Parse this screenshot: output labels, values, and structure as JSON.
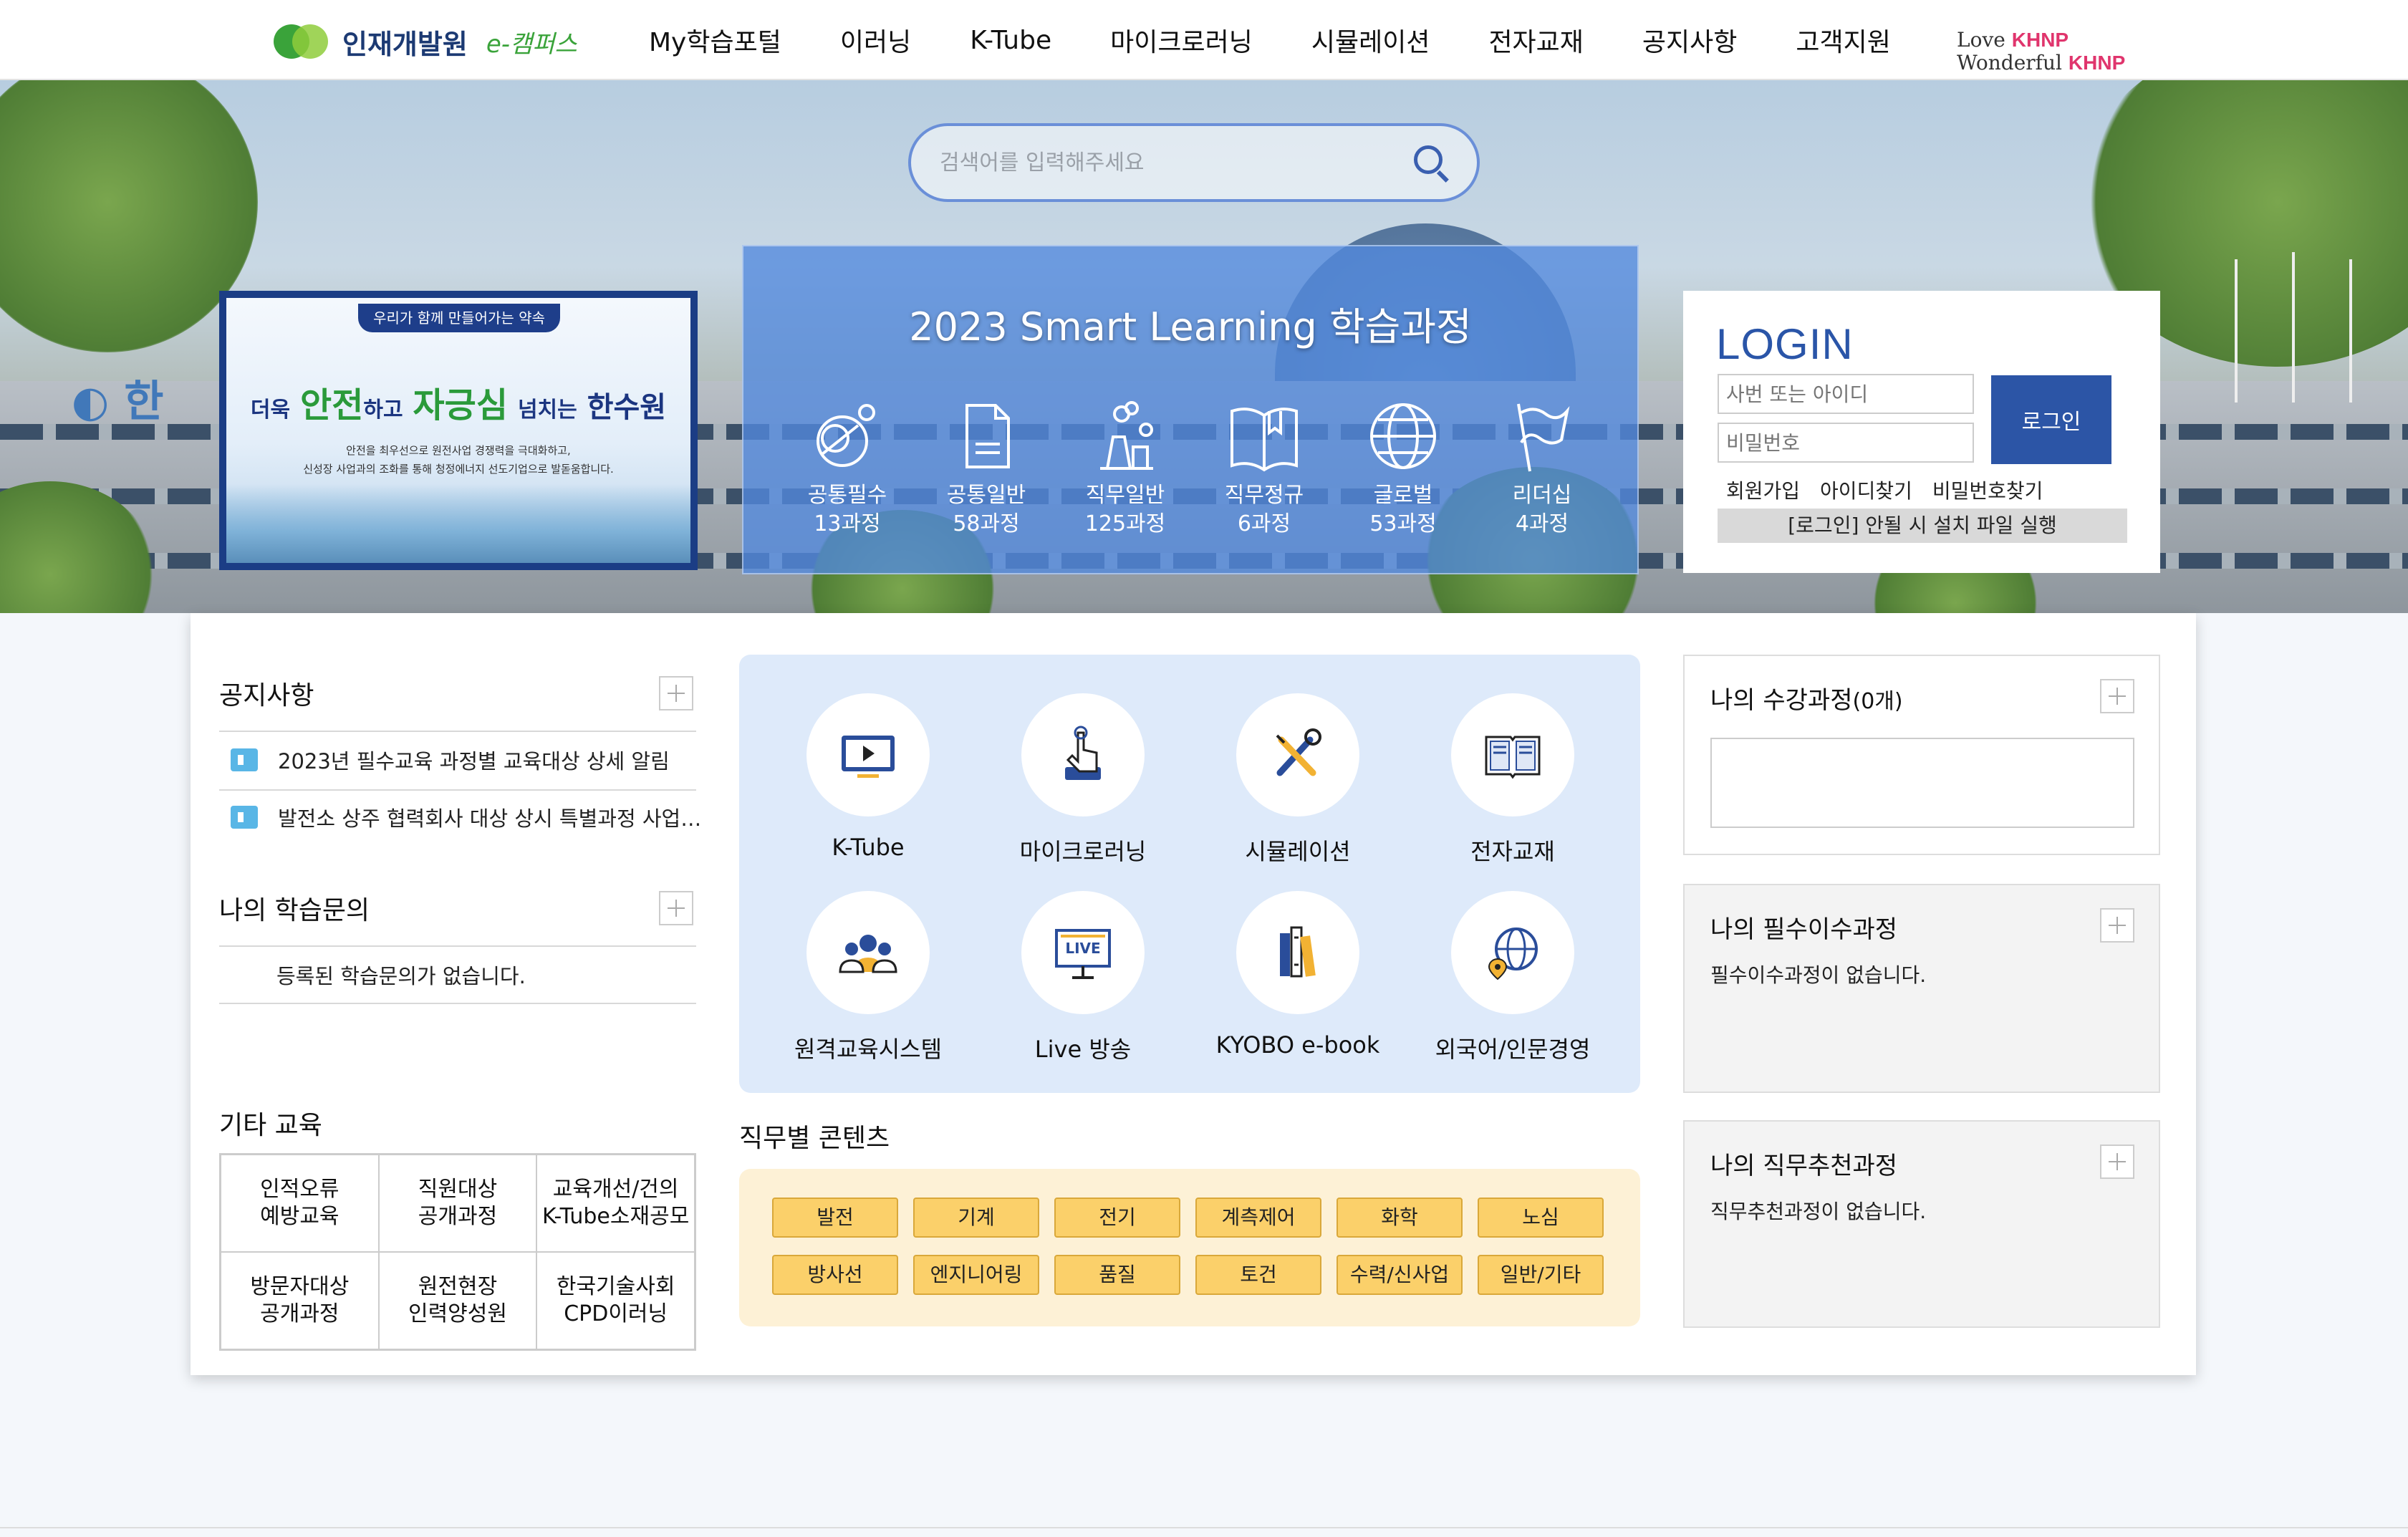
{
  "header": {
    "logo_title": "인재개발원",
    "logo_sub": "e-캠퍼스",
    "nav": [
      "My학습포털",
      "이러닝",
      "K-Tube",
      "마이크로러닝",
      "시뮬레이션",
      "전자교재",
      "공지사항",
      "고객지원"
    ]
  },
  "hero": {
    "search_placeholder": "검색어를 입력해주세요",
    "khnp_tag_line1": "Love",
    "khnp_tag_line2": "Wonderful",
    "khnp_brand": "KHNP",
    "promo": {
      "badge": "우리가 함께 만들어가는 약속",
      "main_1": "더욱",
      "main_2": "안전",
      "main_3": "하고",
      "main_4": "자긍심",
      "main_5": "넘치는",
      "main_6": "한수원",
      "desc_1": "안전을 최우선으로 원전사업 경쟁력을 극대화하고,",
      "desc_2": "신성장 사업과의 조화를 통해 청정에너지 선도기업으로 발돋움합니다."
    },
    "smart": {
      "title": "2023 Smart Learning 학습과정",
      "items": [
        {
          "label": "공통필수",
          "count": "13과정",
          "icon": "circles-icon"
        },
        {
          "label": "공통일반",
          "count": "58과정",
          "icon": "document-icon"
        },
        {
          "label": "직무일반",
          "count": "125과정",
          "icon": "plant-icon"
        },
        {
          "label": "직무정규",
          "count": "6과정",
          "icon": "book-icon"
        },
        {
          "label": "글로벌",
          "count": "53과정",
          "icon": "globe-icon"
        },
        {
          "label": "리더십",
          "count": "4과정",
          "icon": "flag-icon"
        }
      ]
    },
    "login": {
      "title": "LOGIN",
      "id_placeholder": "사번 또는 아이디",
      "pw_placeholder": "비밀번호",
      "button": "로그인",
      "links": [
        "회원가입",
        "아이디찾기",
        "비밀번호찾기"
      ],
      "install": "[로그인] 안될 시 설치 파일 실행"
    }
  },
  "left": {
    "notice_title": "공지사항",
    "notices": [
      "2023년 필수교육 과정별 교육대상 상세 알림",
      "발전소 상주 협력회사 대상 상시 특별과정 사업…"
    ],
    "inquiry_title": "나의 학습문의",
    "inquiry_empty": "등록된 학습문의가 없습니다.",
    "other_title": "기타 교육",
    "other_items": [
      "인적오류\n예방교육",
      "직원대상\n공개과정",
      "교육개선/건의\nK-Tube소재공모",
      "방문자대상\n공개과정",
      "원전현장\n인력양성원",
      "한국기술사회\nCPD이러닝"
    ]
  },
  "center": {
    "services": [
      {
        "label": "K-Tube",
        "icon": "play-icon"
      },
      {
        "label": "마이크로러닝",
        "icon": "touch-icon"
      },
      {
        "label": "시뮬레이션",
        "icon": "tools-icon"
      },
      {
        "label": "전자교재",
        "icon": "ebook-icon"
      },
      {
        "label": "원격교육시스템",
        "icon": "group-icon"
      },
      {
        "label": "Live 방송",
        "icon": "live-icon"
      },
      {
        "label": "KYOBO e-book",
        "icon": "books-icon"
      },
      {
        "label": "외국어/인문경영",
        "icon": "globe-pin-icon"
      }
    ],
    "jobs_title": "직무별 콘텐츠",
    "jobs": [
      "발전",
      "기계",
      "전기",
      "계측제어",
      "화학",
      "노심",
      "방사선",
      "엔지니어링",
      "품질",
      "토건",
      "수력/신사업",
      "일반/기타"
    ]
  },
  "right": {
    "my_courses_title": "나의 수강과정",
    "my_courses_count": "(0개)",
    "required_title": "나의 필수이수과정",
    "required_empty": "필수이수과정이 없습니다.",
    "recommend_title": "나의 직무추천과정",
    "recommend_empty": "직무추천과정이 없습니다."
  }
}
